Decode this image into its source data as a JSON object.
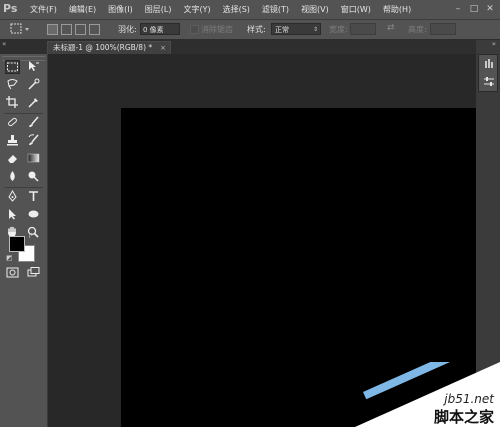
{
  "app": {
    "logo": "Ps"
  },
  "menu": [
    "文件(F)",
    "编辑(E)",
    "图像(I)",
    "图层(L)",
    "文字(Y)",
    "选择(S)",
    "滤镜(T)",
    "视图(V)",
    "窗口(W)",
    "帮助(H)"
  ],
  "window_controls": {
    "minimize": "–",
    "restore": "□",
    "close": "✕"
  },
  "options": {
    "feather_label": "羽化:",
    "feather_value": "0 像素",
    "antialias_label": "消除锯齿",
    "style_label": "样式:",
    "style_value": "正常",
    "width_label": "宽度:",
    "height_label": "高度:"
  },
  "document_tab": {
    "title": "未标题-1 @ 100%(RGB/8) *",
    "close": "×"
  },
  "colors": {
    "foreground": "#000000",
    "background": "#ffffff",
    "canvas": "#000000",
    "ui_panel": "#535353",
    "workspace": "#282828"
  },
  "watermark": {
    "site": "jb51.net",
    "name": "脚本之家"
  },
  "icons": {
    "panel_collapse": "«",
    "right_collapse": "»",
    "swap": "⇄",
    "tools": [
      "marquee-icon",
      "move-icon",
      "lasso-icon",
      "quick-select-icon",
      "crop-icon",
      "eyedropper-icon",
      "healing-brush-icon",
      "brush-icon",
      "clone-stamp-icon",
      "history-brush-icon",
      "eraser-icon",
      "gradient-icon",
      "blur-icon",
      "dodge-icon",
      "pen-icon",
      "type-icon",
      "path-select-icon",
      "shape-icon",
      "hand-icon",
      "zoom-icon",
      "quick-mask-icon",
      "screen-mode-icon"
    ]
  }
}
